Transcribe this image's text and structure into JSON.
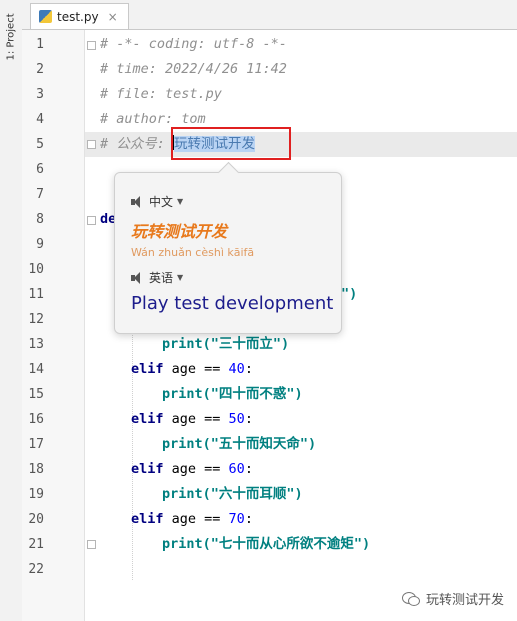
{
  "sidebar": {
    "project_tab": "1: Project"
  },
  "tabs": [
    {
      "label": "test.py"
    }
  ],
  "editor": {
    "lines": [
      {
        "n": "1"
      },
      {
        "n": "2"
      },
      {
        "n": "3"
      },
      {
        "n": "4"
      },
      {
        "n": "5"
      },
      {
        "n": "6"
      },
      {
        "n": "7"
      },
      {
        "n": "8"
      },
      {
        "n": "9"
      },
      {
        "n": "10"
      },
      {
        "n": "11"
      },
      {
        "n": "12"
      },
      {
        "n": "13"
      },
      {
        "n": "14"
      },
      {
        "n": "15"
      },
      {
        "n": "16"
      },
      {
        "n": "17"
      },
      {
        "n": "18"
      },
      {
        "n": "19"
      },
      {
        "n": "20"
      },
      {
        "n": "21"
      },
      {
        "n": "22"
      }
    ],
    "code": {
      "l1": "# -*- coding: utf-8 -*-",
      "l2": "# time: 2022/4/26 11:42",
      "l3": "# file: test.py",
      "l4": "# author: tom",
      "l5_prefix": "# 公众号: ",
      "l5_selected": "玩转测试开发",
      "l8": "de",
      "l11_tail": "\")",
      "l13": "print(\"三十而立\")",
      "l14_kw": "elif",
      "l14_rest": " age == ",
      "l14_num": "40",
      "l14_colon": ":",
      "l15": "print(\"四十而不惑\")",
      "l16_kw": "elif",
      "l16_rest": " age == ",
      "l16_num": "50",
      "l16_colon": ":",
      "l17": "print(\"五十而知天命\")",
      "l18_kw": "elif",
      "l18_rest": " age == ",
      "l18_num": "60",
      "l18_colon": ":",
      "l19": "print(\"六十而耳顺\")",
      "l20_kw": "elif",
      "l20_rest": " age == ",
      "l20_num": "70",
      "l20_colon": ":",
      "l21": "print(\"七十而从心所欲不逾矩\")",
      "print_fn": "print"
    }
  },
  "translation_popup": {
    "source_lang": "中文",
    "source_word": "玩转测试开发",
    "pinyin": "Wán zhuǎn cèshì kāifā",
    "target_lang": "英语",
    "translation": "Play test development"
  },
  "watermark": {
    "text": "玩转测试开发"
  }
}
